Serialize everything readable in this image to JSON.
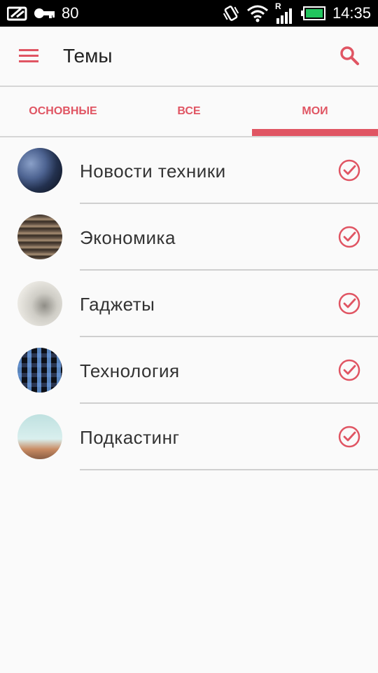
{
  "status_bar": {
    "battery_level_text": "80",
    "time": "14:35",
    "network_label": "R"
  },
  "app_bar": {
    "title": "Темы",
    "menu_icon": "menu-icon",
    "search_icon": "search-icon"
  },
  "tabs": [
    {
      "label": "ОСНОВНЫЕ",
      "active": false
    },
    {
      "label": "ВСЕ",
      "active": false
    },
    {
      "label": "МОИ",
      "active": true
    }
  ],
  "topics": [
    {
      "label": "Новости техники",
      "checked": true
    },
    {
      "label": "Экономика",
      "checked": true
    },
    {
      "label": "Гаджеты",
      "checked": true
    },
    {
      "label": "Технология",
      "checked": true
    },
    {
      "label": "Подкастинг",
      "checked": true
    }
  ],
  "colors": {
    "accent": "#e05563",
    "status_bar_bg": "#000000",
    "background": "#fafafa",
    "battery_fill": "#22c55e"
  }
}
